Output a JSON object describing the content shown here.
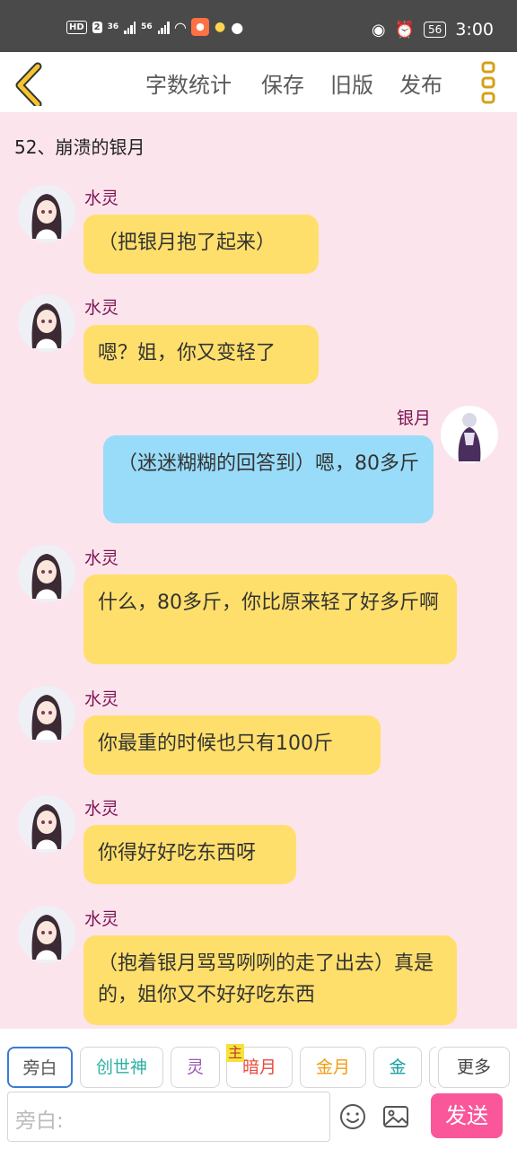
{
  "status_bar": {
    "hd": "HD",
    "sim": "2",
    "net1": "36",
    "net2": "56",
    "battery": "56",
    "time": "3:00"
  },
  "toolbar": {
    "word_count": "字数统计",
    "save": "保存",
    "old_version": "旧版",
    "publish": "发布"
  },
  "chapter_title": "52、崩溃的银月",
  "messages": [
    {
      "sender": "水灵",
      "text": "（把银月抱了起来）"
    },
    {
      "sender": "水灵",
      "text": "嗯？姐，你又变轻了"
    },
    {
      "sender": "银月",
      "text": "（迷迷糊糊的回答到）嗯，80多斤"
    },
    {
      "sender": "水灵",
      "text": "什么，80多斤，你比原来轻了好多斤啊"
    },
    {
      "sender": "水灵",
      "text": "你最重的时候也只有100斤"
    },
    {
      "sender": "水灵",
      "text": "你得好好吃东西呀"
    },
    {
      "sender": "水灵",
      "text": "（抱着银月骂骂咧咧的走了出去）真是的，姐你又不好好吃东西"
    }
  ],
  "roles": [
    "旁白",
    "创世神",
    "灵",
    "暗月",
    "金月",
    "金"
  ],
  "role_main_badge": "主",
  "more_roles": "更多",
  "input": {
    "placeholder": "旁白:"
  },
  "send": "发送",
  "colors": {
    "background": "#fce4ec",
    "bubble_yellow": "#ffdf6b",
    "bubble_blue": "#99dcf9",
    "sender_name": "#7b1454",
    "send_button": "#f9579a",
    "back_arrow": "#e0a800"
  },
  "icons": [
    "back-arrow-icon",
    "more-vertical-icon",
    "emoji-icon",
    "image-icon"
  ]
}
